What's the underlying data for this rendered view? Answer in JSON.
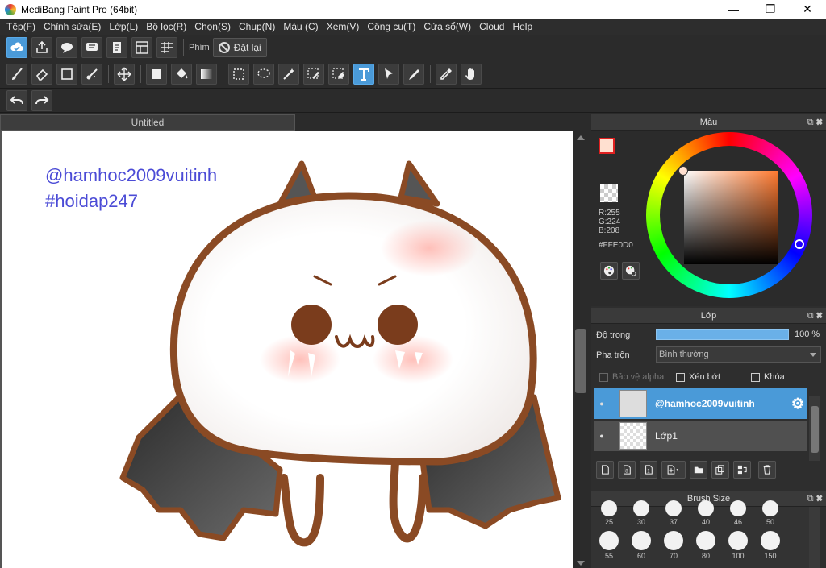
{
  "window": {
    "title": "MediBang Paint Pro (64bit)",
    "minimize": "—",
    "maximize": "❐",
    "close": "✕"
  },
  "menu": [
    "Tệp(F)",
    "Chỉnh sửa(E)",
    "Lớp(L)",
    "Bộ lọc(R)",
    "Chọn(S)",
    "Chụp(N)",
    "Màu (C)",
    "Xem(V)",
    "Công cụ(T)",
    "Cửa sổ(W)",
    "Cloud",
    "Help"
  ],
  "toolbar1": {
    "phim_label": "Phím",
    "reset_label": "Đặt lại"
  },
  "document": {
    "tab_title": "Untitled",
    "watermark_line1": "@hamhoc2009vuitinh",
    "watermark_line2": "#hoidap247"
  },
  "color_panel": {
    "title": "Màu",
    "controls": "⧉ ✖",
    "r": "R:255",
    "g": "G:224",
    "b": "B:208",
    "hex": "#FFE0D0",
    "fg_color": "#FFE0D0",
    "bg_color": "#FFF4D0"
  },
  "layer_panel": {
    "title": "Lớp",
    "controls": "⧉ ✖",
    "opacity_label": "Độ trong",
    "opacity_value": "100 %",
    "blend_label": "Pha trộn",
    "blend_value": "Bình thường",
    "protect_alpha": "Bảo vệ alpha",
    "clipping": "Xén bớt",
    "lock": "Khóa",
    "layers": [
      {
        "name": "@hamhoc2009vuitinh",
        "selected": true
      },
      {
        "name": "Lớp1",
        "selected": false
      }
    ]
  },
  "brush_panel": {
    "title": "Brush Size",
    "controls": "⧉ ✖",
    "row1": [
      "25",
      "30",
      "37",
      "40",
      "46",
      "50"
    ],
    "row2": [
      "55",
      "60",
      "70",
      "80",
      "100",
      "150"
    ]
  },
  "accent_color": "#4A9AD8"
}
